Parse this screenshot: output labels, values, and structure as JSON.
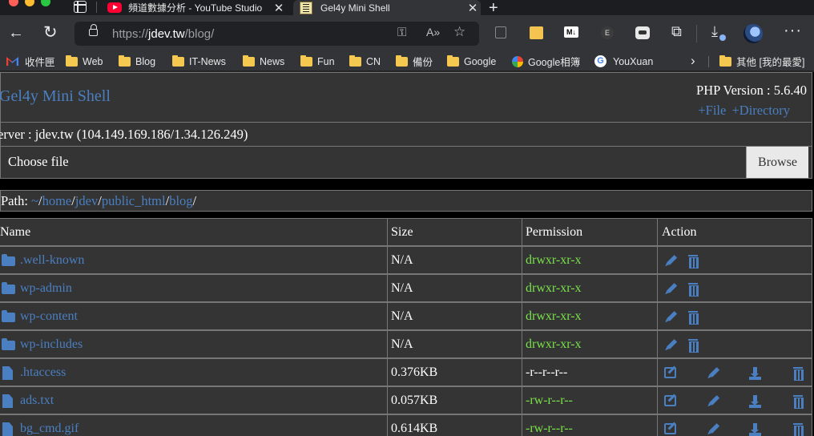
{
  "browser": {
    "tabs": [
      {
        "title": "頻道數據分析 - YouTube Studio",
        "icon": "youtube-icon"
      },
      {
        "title": "Gel4y Mini Shell",
        "icon": "shell-icon",
        "active": true
      }
    ],
    "address_bar": {
      "scheme": "https://",
      "host": "jdev.tw",
      "path": "/blog/"
    },
    "bookmarks": [
      {
        "label": "收件匣",
        "icon": "gmail-icon"
      },
      {
        "label": "Web",
        "icon": "folder-icon"
      },
      {
        "label": "Blog",
        "icon": "folder-icon"
      },
      {
        "label": "IT-News",
        "icon": "folder-icon"
      },
      {
        "label": "News",
        "icon": "folder-icon"
      },
      {
        "label": "Fun",
        "icon": "folder-icon"
      },
      {
        "label": "CN",
        "icon": "folder-icon"
      },
      {
        "label": "備份",
        "icon": "folder-icon"
      },
      {
        "label": "Google",
        "icon": "folder-icon"
      },
      {
        "label": "Google相簿",
        "icon": "google-photos-icon"
      },
      {
        "label": "YouXuan",
        "icon": "google-icon"
      },
      {
        "label": "其他 [我的最愛]",
        "icon": "folder-icon"
      }
    ],
    "extension_md_label": "M↓",
    "extension_e_label": "E"
  },
  "shell": {
    "title": "Gel4y Mini Shell",
    "php_version": "PHP Version : 5.6.40",
    "new_file": "+File",
    "new_directory": "+Directory",
    "server": "erver : jdev.tw (104.149.169.186/1.34.126.249)",
    "choose_file": "Choose file",
    "browse": "Browse",
    "path_label": "Path: ",
    "path_segments": [
      "~",
      "home",
      "jdev",
      "public_html",
      "blog"
    ]
  },
  "table": {
    "headers": {
      "name": "Name",
      "size": "Size",
      "permission": "Permission",
      "action": "Action"
    },
    "rows": [
      {
        "name": ".well-known",
        "type": "dir",
        "size": "N/A",
        "perm": "drwxr-xr-x",
        "writable": true
      },
      {
        "name": "wp-admin",
        "type": "dir",
        "size": "N/A",
        "perm": "drwxr-xr-x",
        "writable": true
      },
      {
        "name": "wp-content",
        "type": "dir",
        "size": "N/A",
        "perm": "drwxr-xr-x",
        "writable": true
      },
      {
        "name": "wp-includes",
        "type": "dir",
        "size": "N/A",
        "perm": "drwxr-xr-x",
        "writable": true
      },
      {
        "name": ".htaccess",
        "type": "file",
        "size": "0.376KB",
        "perm": "-r--r--r--",
        "writable": false
      },
      {
        "name": "ads.txt",
        "type": "file",
        "size": "0.057KB",
        "perm": "-rw-r--r--",
        "writable": true
      },
      {
        "name": "bg_cmd.gif",
        "type": "file",
        "size": "0.614KB",
        "perm": "-rw-r--r--",
        "writable": true
      }
    ]
  },
  "colors": {
    "link": "#4a7fc1",
    "writable_perm": "#7ae24a",
    "panel": "#343434",
    "border": "#777777"
  }
}
